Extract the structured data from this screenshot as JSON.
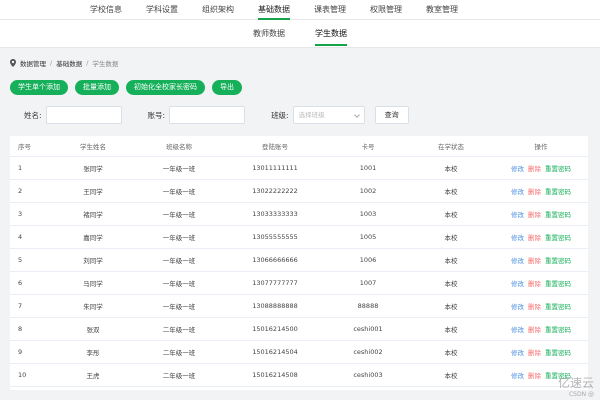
{
  "topnav": [
    "学校信息",
    "学科设置",
    "组织架构",
    "基础数据",
    "课表管理",
    "权限管理",
    "教室管理"
  ],
  "subtabs": [
    "教师数据",
    "学生数据"
  ],
  "breadcrumb": [
    "数据管理",
    "基础数据",
    "学生数据"
  ],
  "buttons": {
    "add_one": "学生单个添加",
    "batch_add": "批量添加",
    "init_pwd": "初始化全校家长密码",
    "export": "导出"
  },
  "filters": {
    "name_label": "姓名:",
    "account_label": "账号:",
    "class_label": "班级:",
    "class_placeholder": "选择班级",
    "query": "查询"
  },
  "table": {
    "headers": [
      "序号",
      "学生姓名",
      "班级名称",
      "登陆账号",
      "卡号",
      "在学状态",
      "操作"
    ],
    "actions": {
      "edit": "修改",
      "delete": "删除",
      "reset": "重置密码"
    },
    "rows": [
      [
        "1",
        "张同学",
        "一年级一班",
        "13011111111",
        "1001",
        "本校"
      ],
      [
        "2",
        "王同学",
        "一年级一班",
        "13022222222",
        "1002",
        "本校"
      ],
      [
        "3",
        "褚同学",
        "一年级一班",
        "13033333333",
        "1003",
        "本校"
      ],
      [
        "4",
        "嘉同学",
        "一年级一班",
        "13055555555",
        "1005",
        "本校"
      ],
      [
        "5",
        "刘同学",
        "一年级一班",
        "13066666666",
        "1006",
        "本校"
      ],
      [
        "6",
        "马同学",
        "一年级一班",
        "13077777777",
        "1007",
        "本校"
      ],
      [
        "7",
        "朱同学",
        "一年级一班",
        "13088888888",
        "88888",
        "本校"
      ],
      [
        "8",
        "张双",
        "二年级一班",
        "15016214500",
        "ceshi001",
        "本校"
      ],
      [
        "9",
        "李彤",
        "二年级一班",
        "15016214504",
        "ceshi002",
        "本校"
      ],
      [
        "10",
        "王虎",
        "二年级一班",
        "15016214508",
        "ceshi003",
        "本校"
      ]
    ]
  },
  "watermark": {
    "logo": "亿速云",
    "csdn": "CSDN @"
  },
  "colors": {
    "accent": "#16b05a",
    "edit": "#4a90e2",
    "delete": "#f56c6c"
  }
}
